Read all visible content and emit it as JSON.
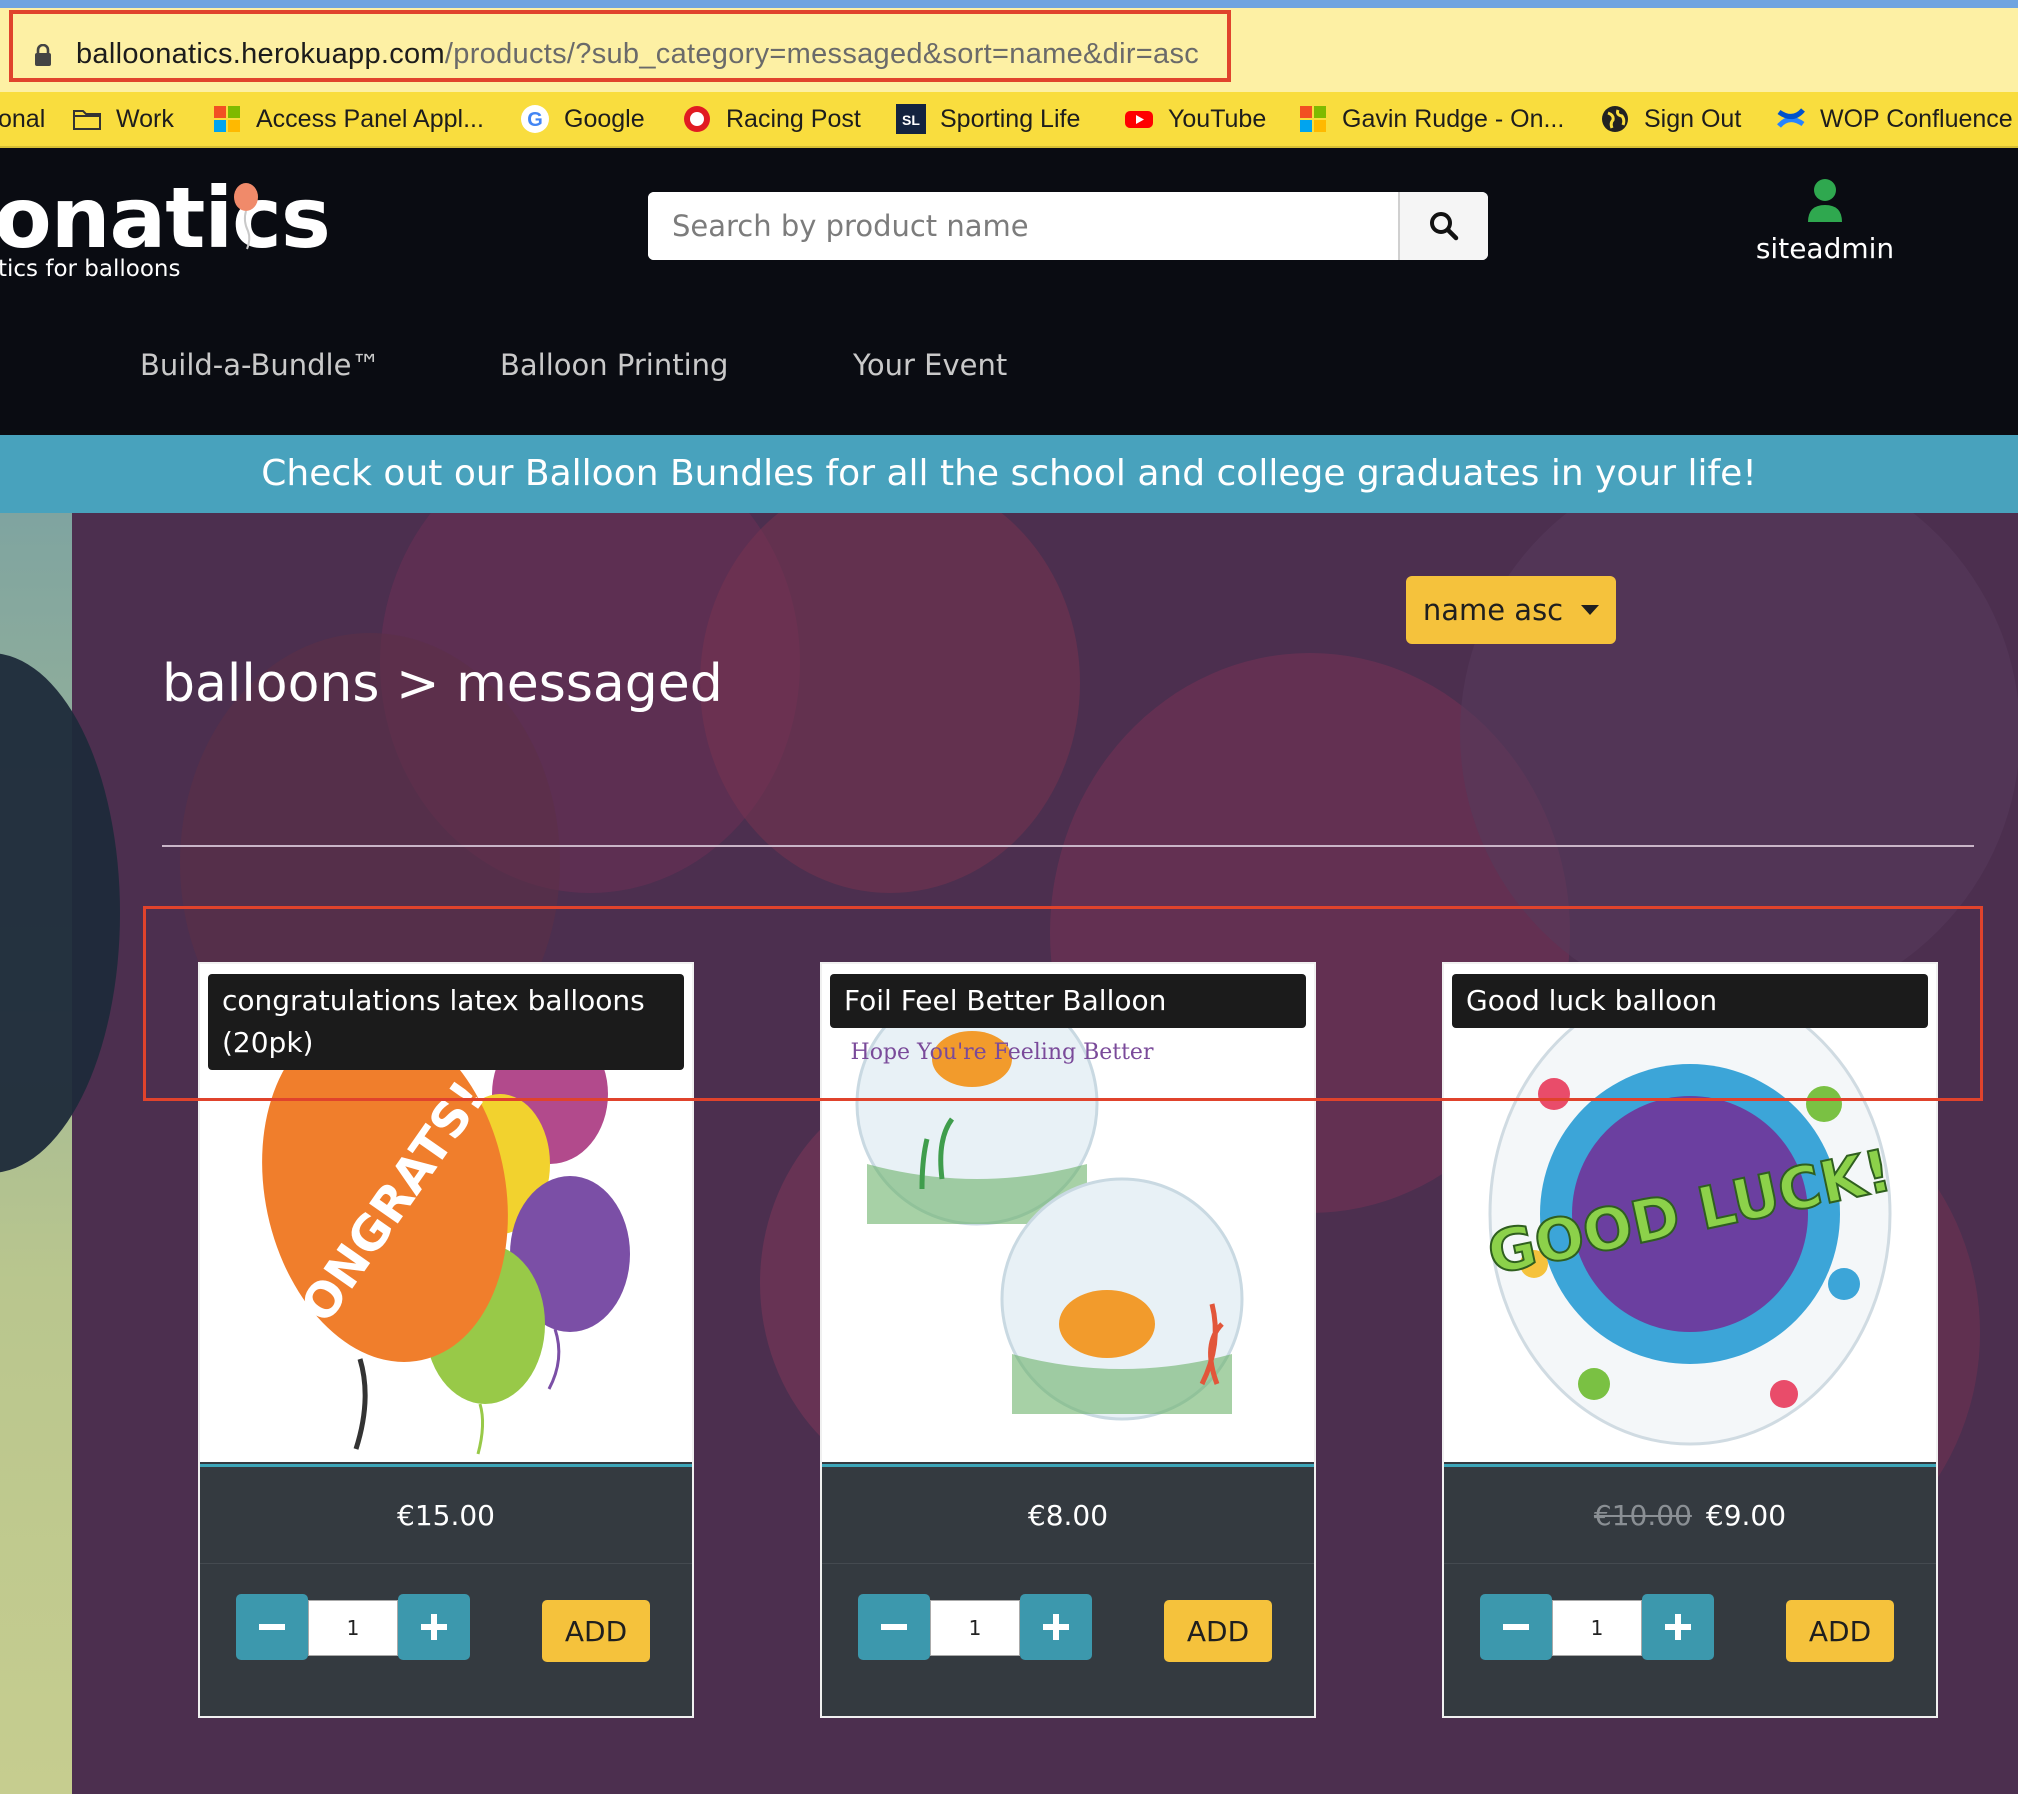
{
  "browser": {
    "url_host": "balloonatics.herokuapp.com",
    "url_path": "/products/?sub_category=messaged&sort=name&dir=asc",
    "bookmarks": [
      {
        "label": "onal",
        "icon": "none"
      },
      {
        "label": "Work",
        "icon": "folder-icon"
      },
      {
        "label": "Access Panel Appl...",
        "icon": "microsoft-icon"
      },
      {
        "label": "Google",
        "icon": "google-icon"
      },
      {
        "label": "Racing Post",
        "icon": "racing-post-icon"
      },
      {
        "label": "Sporting Life",
        "icon": "sporting-life-icon"
      },
      {
        "label": "YouTube",
        "icon": "youtube-icon"
      },
      {
        "label": "Gavin Rudge - On...",
        "icon": "microsoft-icon"
      },
      {
        "label": "Sign Out",
        "icon": "globe-icon"
      },
      {
        "label": "WOP Confluence",
        "icon": "confluence-icon"
      }
    ]
  },
  "header": {
    "logo_text": "onatics",
    "tagline": "tics for balloons",
    "search_placeholder": "Search by product name",
    "user_name": "siteadmin",
    "nav": [
      {
        "label": "Build-a-Bundle™"
      },
      {
        "label": "Balloon Printing"
      },
      {
        "label": "Your Event"
      }
    ]
  },
  "banner": {
    "text": "Check out our Balloon Bundles for all the school and college graduates in your life!"
  },
  "main": {
    "sort_label": "name asc",
    "breadcrumb_title": "balloons > messaged"
  },
  "products": [
    {
      "title": "congratulations latex balloons (20pk)",
      "price": "€15.00",
      "old_price": "",
      "quantity": "1",
      "add_label": "ADD",
      "image_text": "CONGRATS!"
    },
    {
      "title": "Foil Feel Better Balloon",
      "price": "€8.00",
      "old_price": "",
      "quantity": "1",
      "add_label": "ADD",
      "image_text": "Hope You're Feeling Better"
    },
    {
      "title": "Good luck balloon",
      "price": "€9.00",
      "old_price": "€10.00",
      "quantity": "1",
      "add_label": "ADD",
      "image_text": "GOOD LUCK!"
    }
  ],
  "colors": {
    "header_bg": "#0a0c12",
    "banner_bg": "#48a2bd",
    "accent_yellow": "#f5c23c",
    "qty_button": "#3c98ad",
    "card_bg": "#343a40",
    "annotation_red": "#e0432c"
  }
}
